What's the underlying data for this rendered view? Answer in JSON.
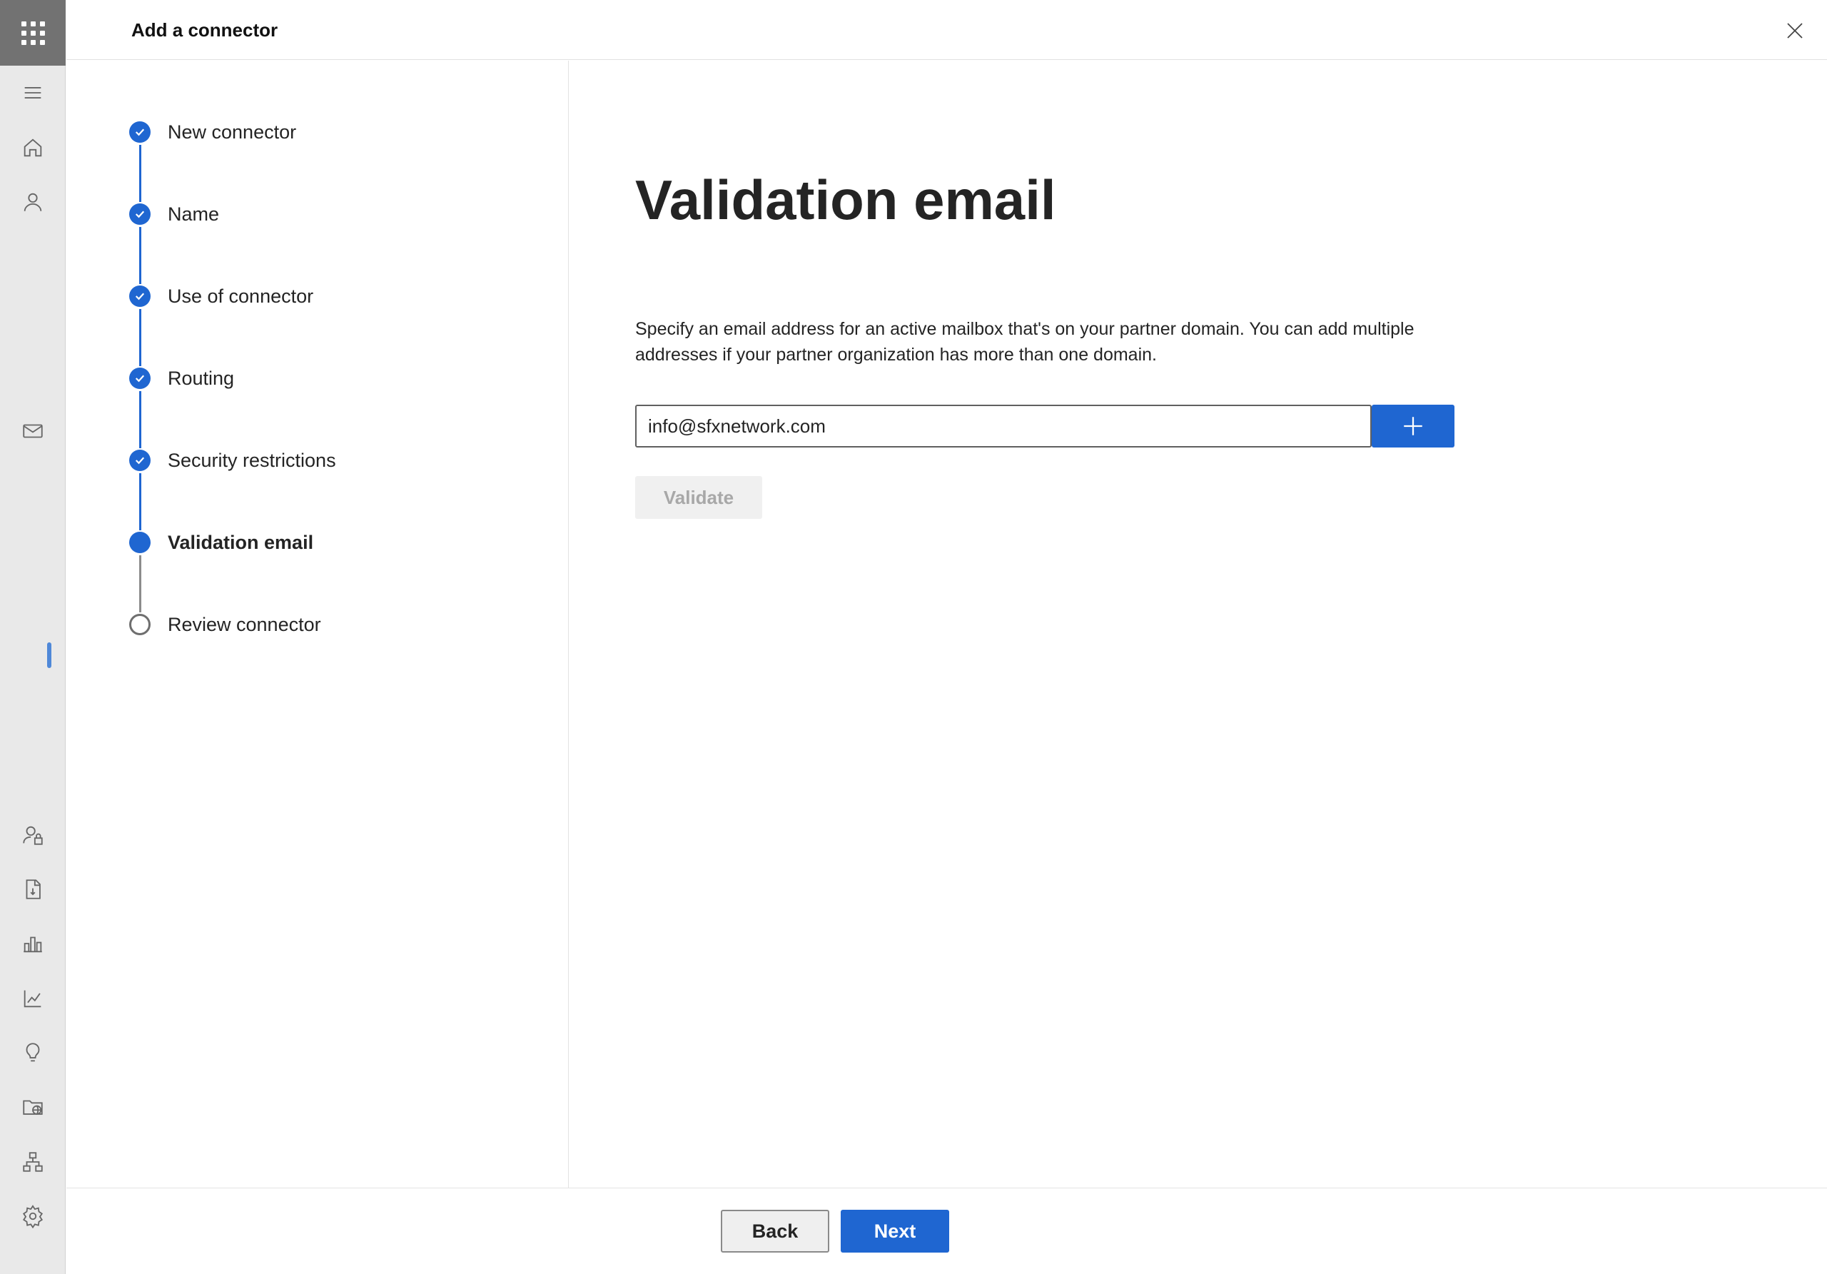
{
  "header": {
    "title": "Add a connector"
  },
  "steps": [
    {
      "label": "New connector",
      "status": "done"
    },
    {
      "label": "Name",
      "status": "done"
    },
    {
      "label": "Use of connector",
      "status": "done"
    },
    {
      "label": "Routing",
      "status": "done"
    },
    {
      "label": "Security restrictions",
      "status": "done"
    },
    {
      "label": "Validation email",
      "status": "current"
    },
    {
      "label": "Review connector",
      "status": "pending"
    }
  ],
  "main": {
    "title": "Validation email",
    "description": "Specify an email address for an active mailbox that's on your partner domain. You can add multiple addresses if your partner organization has more than one domain.",
    "email_value": "info@sfxnetwork.com",
    "validate_label": "Validate"
  },
  "footer": {
    "back_label": "Back",
    "next_label": "Next"
  },
  "colors": {
    "accent": "#1f66d1",
    "rail_bg": "#e9e9e9",
    "waffle_bg": "#727272"
  },
  "rail_icons": [
    "menu-icon",
    "home-icon",
    "user-icon",
    "mail-icon",
    "user-lock-icon",
    "report-icon",
    "bar-chart-icon",
    "trend-chart-icon",
    "lightbulb-icon",
    "folder-globe-icon",
    "org-chart-icon",
    "settings-icon"
  ]
}
